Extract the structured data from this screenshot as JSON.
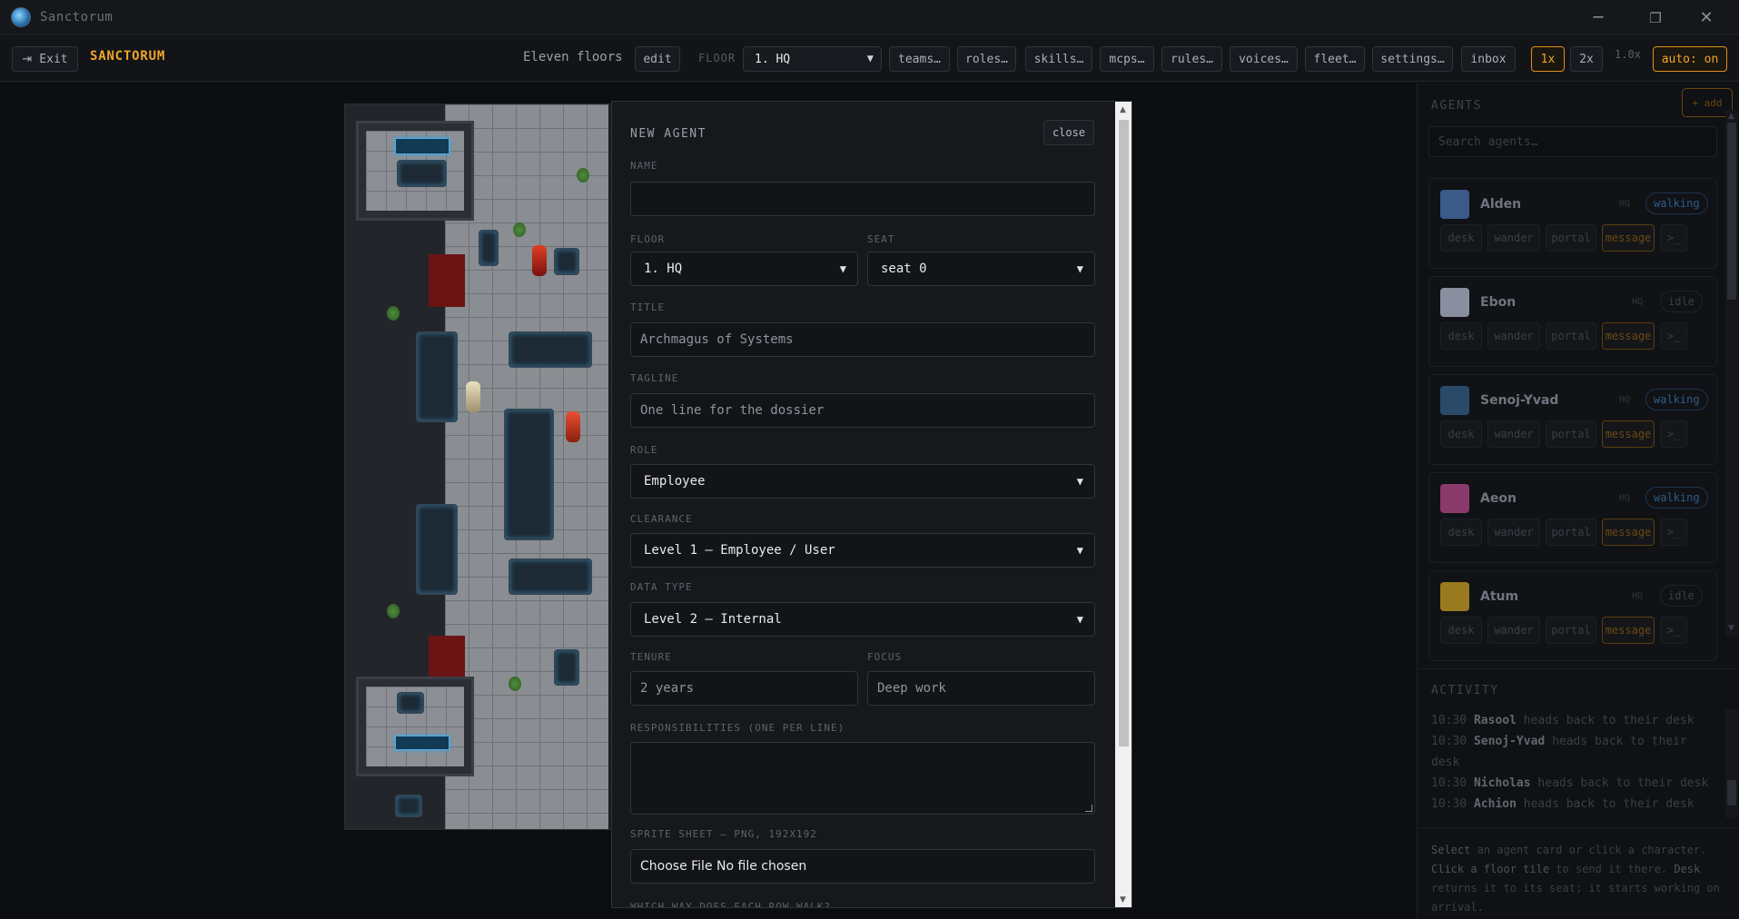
{
  "window": {
    "title": "Sanctorum",
    "minimize": "─",
    "restore": "❐",
    "close": "✕"
  },
  "toolbar": {
    "exit_label": "Exit",
    "brand": "SANCTORUM",
    "building_name": "Eleven floors",
    "edit_label": "edit",
    "floor_label": "FLOOR",
    "floor_value": "1. HQ",
    "menu_buttons": [
      "teams…",
      "roles…",
      "skills…",
      "mcps…",
      "rules…",
      "voices…",
      "fleet…",
      "settings…",
      "inbox"
    ],
    "speed_buttons": [
      "1x",
      "2x"
    ],
    "speed_readout": "1.0x",
    "auto_label": "auto: on",
    "active_speed": "1x"
  },
  "modal": {
    "title": "NEW AGENT",
    "close_label": "close",
    "name_label": "NAME",
    "name_value": "",
    "floor_label": "FLOOR",
    "floor_value": "1. HQ",
    "seat_label": "SEAT",
    "seat_value": "seat 0",
    "title_label": "TITLE",
    "title_placeholder": "Archmagus of Systems",
    "tagline_label": "TAGLINE",
    "tagline_placeholder": "One line for the dossier",
    "role_label": "ROLE",
    "role_value": "Employee",
    "clearance_label": "CLEARANCE",
    "clearance_value": "Level 1 — Employee / User",
    "datatype_label": "DATA TYPE",
    "datatype_value": "Level 2 — Internal",
    "tenure_label": "TENURE",
    "tenure_placeholder": "2 years",
    "focus_label": "FOCUS",
    "focus_placeholder": "Deep work",
    "responsibilities_label": "RESPONSIBILITIES (ONE PER LINE)",
    "sprite_label": "SPRITE SHEET — PNG, 192X192",
    "sprite_value": "Choose File No file chosen",
    "walk_label": "WHICH WAY DOES EACH ROW WALK?"
  },
  "panel": {
    "agents_heading": "AGENTS",
    "add_label": "+ add",
    "search_placeholder": "Search agents…",
    "agents": [
      {
        "name": "Alden",
        "floor": "HQ",
        "state": "walking",
        "avatar_color": "#3a5a8a"
      },
      {
        "name": "Ebon",
        "floor": "HQ",
        "state": "idle",
        "avatar_color": "#8a8fa0"
      },
      {
        "name": "Senoj-Yvad",
        "floor": "HQ",
        "state": "walking",
        "avatar_color": "#2a4a6a"
      },
      {
        "name": "Aeon",
        "floor": "HQ",
        "state": "walking",
        "avatar_color": "#8a3a6a"
      },
      {
        "name": "Atum",
        "floor": "HQ",
        "state": "idle",
        "avatar_color": "#9a7a20"
      }
    ],
    "card_actions": [
      "desk",
      "wander",
      "portal",
      "message",
      ">_"
    ],
    "activity_heading": "ACTIVITY",
    "activity": [
      {
        "time": "10:30",
        "who": "Rasool",
        "text": "heads back to their desk"
      },
      {
        "time": "10:30",
        "who": "Senoj-Yvad",
        "text": "heads back to their desk"
      },
      {
        "time": "10:30",
        "who": "Nicholas",
        "text": "heads back to their desk"
      },
      {
        "time": "10:30",
        "who": "Achion",
        "text": "heads back to their desk"
      }
    ],
    "help": {
      "p1": "Select",
      "p2": "an agent card or click a character.",
      "p3": "Click a floor tile",
      "p4": "to send it there.",
      "p5": "Desk",
      "p6": "returns it to its seat; it starts working on arrival."
    }
  },
  "colors": {
    "accent": "#f0a52a",
    "walking": "#2e5c88",
    "bg": "#0d0f13"
  }
}
